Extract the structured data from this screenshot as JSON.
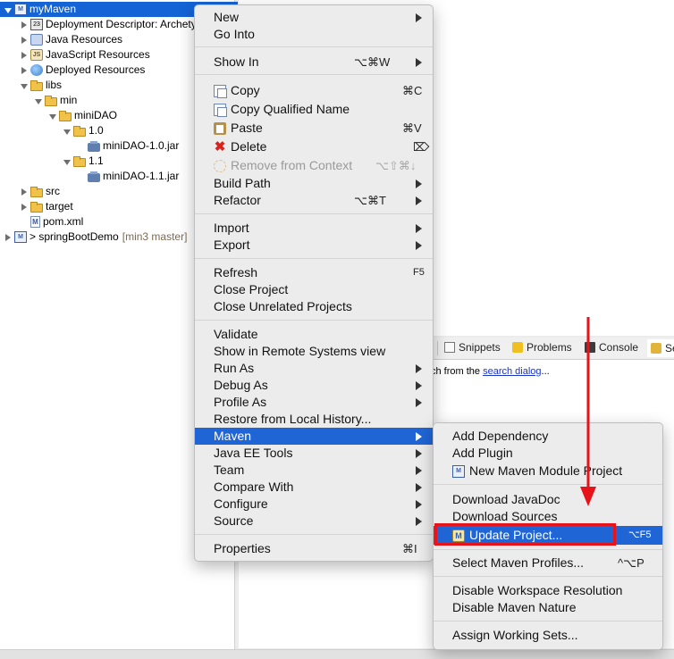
{
  "explorer": {
    "items": [
      {
        "label": "myMaven",
        "extra": "",
        "twisty": "open",
        "icon": "maven-project-icon",
        "selected": true
      },
      {
        "label": "Deployment Descriptor: Archetype",
        "extra": "",
        "twisty": "closed",
        "icon": "deployment-descriptor-icon"
      },
      {
        "label": "Java Resources",
        "extra": "",
        "twisty": "closed",
        "icon": "java-resources-icon"
      },
      {
        "label": "JavaScript Resources",
        "extra": "",
        "twisty": "closed",
        "icon": "javascript-resources-icon"
      },
      {
        "label": "Deployed Resources",
        "extra": "",
        "twisty": "closed",
        "icon": "deployed-resources-icon"
      },
      {
        "label": "libs",
        "extra": "",
        "twisty": "open",
        "icon": "folder-icon"
      },
      {
        "label": "min",
        "extra": "",
        "twisty": "open",
        "icon": "folder-icon"
      },
      {
        "label": "miniDAO",
        "extra": "",
        "twisty": "open",
        "icon": "folder-icon"
      },
      {
        "label": "1.0",
        "extra": "",
        "twisty": "open",
        "icon": "folder-icon"
      },
      {
        "label": "miniDAO-1.0.jar",
        "extra": "",
        "twisty": "none",
        "icon": "jar-file-icon"
      },
      {
        "label": "1.1",
        "extra": "",
        "twisty": "open",
        "icon": "folder-icon"
      },
      {
        "label": "miniDAO-1.1.jar",
        "extra": "",
        "twisty": "none",
        "icon": "jar-file-icon"
      },
      {
        "label": "src",
        "extra": "",
        "twisty": "closed",
        "icon": "folder-icon"
      },
      {
        "label": "target",
        "extra": "",
        "twisty": "closed",
        "icon": "folder-icon"
      },
      {
        "label": "pom.xml",
        "extra": "",
        "twisty": "none",
        "icon": "xml-file-icon"
      },
      {
        "label": "> springBootDemo",
        "extra": "[min3 master]",
        "twisty": "closed",
        "icon": "maven-project-icon"
      }
    ]
  },
  "views": {
    "tabs": [
      "Snippets",
      "Problems",
      "Console",
      "Se"
    ],
    "search_prefix": "ch from the",
    "search_link": "search dialog",
    "search_suffix": "..."
  },
  "context_menu": {
    "new": "New",
    "go_into": "Go Into",
    "show_in": "Show In",
    "show_in_sc": "⌥⌘W",
    "copy": "Copy",
    "copy_sc": "⌘C",
    "copy_qualified": "Copy Qualified Name",
    "paste": "Paste",
    "paste_sc": "⌘V",
    "delete": "Delete",
    "delete_sc": "⌦",
    "remove_context": "Remove from Context",
    "remove_context_sc": "⌥⇧⌘↓",
    "build_path": "Build Path",
    "refactor": "Refactor",
    "refactor_sc": "⌥⌘T",
    "import": "Import",
    "export": "Export",
    "refresh": "Refresh",
    "refresh_sc": "F5",
    "close_project": "Close Project",
    "close_unrelated": "Close Unrelated Projects",
    "validate": "Validate",
    "show_remote": "Show in Remote Systems view",
    "run_as": "Run As",
    "debug_as": "Debug As",
    "profile_as": "Profile As",
    "restore_history": "Restore from Local History...",
    "maven": "Maven",
    "java_ee_tools": "Java EE Tools",
    "team": "Team",
    "compare_with": "Compare With",
    "configure": "Configure",
    "source": "Source",
    "properties": "Properties",
    "properties_sc": "⌘I"
  },
  "maven_menu": {
    "add_dependency": "Add Dependency",
    "add_plugin": "Add Plugin",
    "new_module": "New Maven Module Project",
    "download_javadoc": "Download JavaDoc",
    "download_sources": "Download Sources",
    "update_project": "Update Project...",
    "update_project_sc": "⌥F5",
    "select_profiles": "Select Maven Profiles...",
    "select_profiles_sc": "^⌥P",
    "disable_workspace": "Disable Workspace Resolution",
    "disable_nature": "Disable Maven Nature",
    "assign_working_sets": "Assign Working Sets..."
  },
  "colors": {
    "selection": "#1f65d6",
    "annotation": "#e8121a"
  }
}
